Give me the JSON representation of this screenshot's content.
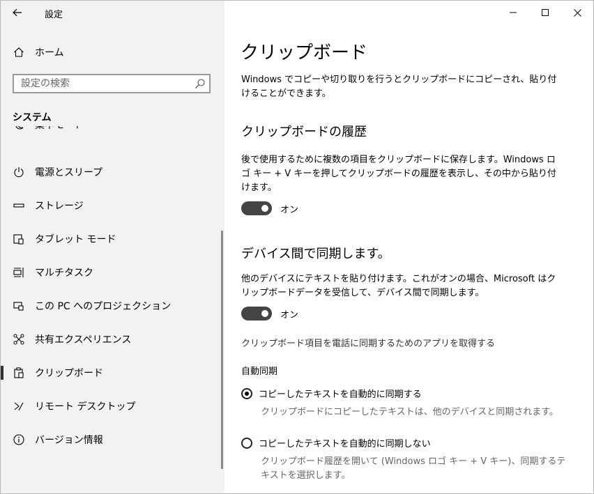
{
  "app": {
    "title": "設定"
  },
  "sidebar": {
    "home_label": "ホーム",
    "search_placeholder": "設定の検索",
    "section_title": "システム",
    "partial_item": "集中モード",
    "items": [
      {
        "label": "電源とスリープ",
        "icon": "power-icon"
      },
      {
        "label": "ストレージ",
        "icon": "storage-icon"
      },
      {
        "label": "タブレット モード",
        "icon": "tablet-mode-icon"
      },
      {
        "label": "マルチタスク",
        "icon": "multitasking-icon"
      },
      {
        "label": "この PC へのプロジェクション",
        "icon": "projection-icon"
      },
      {
        "label": "共有エクスペリエンス",
        "icon": "shared-experiences-icon"
      },
      {
        "label": "クリップボード",
        "icon": "clipboard-icon",
        "selected": true
      },
      {
        "label": "リモート デスクトップ",
        "icon": "remote-desktop-icon"
      },
      {
        "label": "バージョン情報",
        "icon": "info-icon"
      }
    ]
  },
  "main": {
    "title": "クリップボード",
    "intro": "Windows でコピーや切り取りを行うとクリップボードにコピーされ、貼り付けることができます。",
    "history": {
      "heading": "クリップボードの履歴",
      "desc": "後で使用するために複数の項目をクリップボードに保存します。Windows ロゴ キー + V キーを押してクリップボードの履歴を表示し、その中から貼り付けます。",
      "toggle_label": "オン",
      "toggle_on": true
    },
    "sync": {
      "heading": "デバイス間で同期します。",
      "desc": "他のデバイスにテキストを貼り付けます。これがオンの場合、Microsoft はクリップボードデータを受信して、デバイス間で同期します。",
      "toggle_label": "オン",
      "toggle_on": true,
      "link": "クリップボード項目を電話に同期するためのアプリを取得する",
      "auto_sync_title": "自動同期",
      "options": [
        {
          "label": "コピーしたテキストを自動的に同期する",
          "desc": "クリップボードにコピーしたテキストは、他のデバイスと同期されます。",
          "checked": true
        },
        {
          "label": "コピーしたテキストを自動的に同期しない",
          "desc": "クリップボード履歴を開いて (Windows ロゴ キー + V キー)、同期するテキストを選択します。",
          "checked": false
        }
      ]
    }
  },
  "colors": {
    "sidebar_bg": "#f2f2f2",
    "toggle_on": "#444444",
    "text_secondary": "#666666"
  }
}
